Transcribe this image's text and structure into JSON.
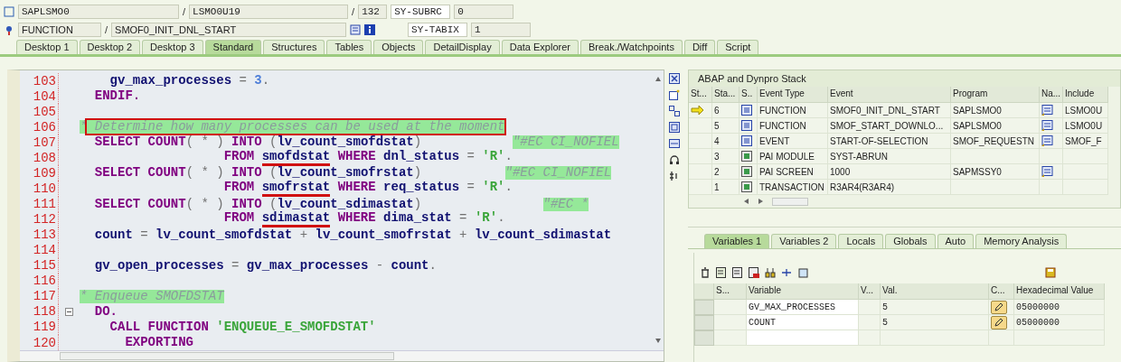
{
  "header": {
    "row_1": {
      "program": "SAPLSMO0",
      "separator_1": "/",
      "include": "LSMO0U19",
      "separator_2": "/",
      "line": "132",
      "field_name": "SY-SUBRC",
      "field_value": "0"
    },
    "row_2": {
      "event_type": "FUNCTION",
      "separator": "/",
      "event": "SMOF0_INIT_DNL_START",
      "field_name": "SY-TABIX",
      "field_value": "1"
    }
  },
  "tabs": [
    {
      "label": "Desktop 1",
      "selected": false
    },
    {
      "label": "Desktop 2",
      "selected": false
    },
    {
      "label": "Desktop 3",
      "selected": false
    },
    {
      "label": "Standard",
      "selected": true
    },
    {
      "label": "Structures",
      "selected": false
    },
    {
      "label": "Tables",
      "selected": false
    },
    {
      "label": "Objects",
      "selected": false
    },
    {
      "label": "DetailDisplay",
      "selected": false
    },
    {
      "label": "Data Explorer",
      "selected": false
    },
    {
      "label": "Break./Watchpoints",
      "selected": false
    },
    {
      "label": "Diff",
      "selected": false
    },
    {
      "label": "Script",
      "selected": false
    }
  ],
  "code": {
    "lines": [
      {
        "number": "103",
        "tokens": [
          {
            "kind": "id",
            "text": "    gv_max_processes"
          },
          {
            "kind": "op",
            "text": " = "
          },
          {
            "kind": "num",
            "text": "3"
          },
          {
            "kind": "op",
            "text": "."
          }
        ]
      },
      {
        "number": "104",
        "tokens": [
          {
            "kind": "kw",
            "text": "  ENDIF."
          }
        ]
      },
      {
        "number": "105"
      },
      {
        "number": "106",
        "tokens": [
          {
            "kind": "comment",
            "text": "*",
            "highlighted": true
          },
          {
            "kind": "comment",
            "text": " Determine how many processes can be used at the moment",
            "highlighted": true,
            "boxed": true
          }
        ]
      },
      {
        "number": "107",
        "tokens": [
          {
            "kind": "kw",
            "text": "  SELECT COUNT"
          },
          {
            "kind": "op",
            "text": "( * ) "
          },
          {
            "kind": "kw",
            "text": "INTO "
          },
          {
            "kind": "op",
            "text": "("
          },
          {
            "kind": "id",
            "text": "lv_count_smofdstat"
          },
          {
            "kind": "op",
            "text": ")            "
          },
          {
            "kind": "comment",
            "text": "\"#EC CI_NOFIEL",
            "highlighted": true
          }
        ]
      },
      {
        "number": "108",
        "tokens": [
          {
            "kind": "kw",
            "text": "                   FROM "
          },
          {
            "kind": "id",
            "text": "smofdstat",
            "marked": true
          },
          {
            "kind": "kw",
            "text": " WHERE "
          },
          {
            "kind": "id",
            "text": "dnl_status"
          },
          {
            "kind": "op",
            "text": " = "
          },
          {
            "kind": "str",
            "text": "'R'"
          },
          {
            "kind": "op",
            "text": "."
          }
        ]
      },
      {
        "number": "109",
        "tokens": [
          {
            "kind": "kw",
            "text": "  SELECT COUNT"
          },
          {
            "kind": "op",
            "text": "( * ) "
          },
          {
            "kind": "kw",
            "text": "INTO "
          },
          {
            "kind": "op",
            "text": "("
          },
          {
            "kind": "id",
            "text": "lv_count_smofrstat"
          },
          {
            "kind": "op",
            "text": ")           "
          },
          {
            "kind": "comment",
            "text": "\"#EC CI_NOFIEL",
            "highlighted": true
          }
        ]
      },
      {
        "number": "110",
        "tokens": [
          {
            "kind": "kw",
            "text": "                   FROM "
          },
          {
            "kind": "id",
            "text": "smofrstat",
            "marked": true
          },
          {
            "kind": "kw",
            "text": " WHERE "
          },
          {
            "kind": "id",
            "text": "req_status"
          },
          {
            "kind": "op",
            "text": " = "
          },
          {
            "kind": "str",
            "text": "'R'"
          },
          {
            "kind": "op",
            "text": "."
          }
        ]
      },
      {
        "number": "111",
        "tokens": [
          {
            "kind": "kw",
            "text": "  SELECT COUNT"
          },
          {
            "kind": "op",
            "text": "( * ) "
          },
          {
            "kind": "kw",
            "text": "INTO "
          },
          {
            "kind": "op",
            "text": "("
          },
          {
            "kind": "id",
            "text": "lv_count_sdimastat"
          },
          {
            "kind": "op",
            "text": ")                "
          },
          {
            "kind": "comment",
            "text": "\"#EC *",
            "highlighted": true
          }
        ]
      },
      {
        "number": "112",
        "tokens": [
          {
            "kind": "kw",
            "text": "                   FROM "
          },
          {
            "kind": "id",
            "text": "sdimastat",
            "marked": true
          },
          {
            "kind": "kw",
            "text": " WHERE "
          },
          {
            "kind": "id",
            "text": "dima_stat"
          },
          {
            "kind": "op",
            "text": " = "
          },
          {
            "kind": "str",
            "text": "'R'"
          },
          {
            "kind": "op",
            "text": "."
          }
        ]
      },
      {
        "number": "113",
        "tokens": [
          {
            "kind": "id",
            "text": "  count"
          },
          {
            "kind": "op",
            "text": " = "
          },
          {
            "kind": "id",
            "text": "lv_count_smofdstat"
          },
          {
            "kind": "op",
            "text": " + "
          },
          {
            "kind": "id",
            "text": "lv_count_smofrstat"
          },
          {
            "kind": "op",
            "text": " + "
          },
          {
            "kind": "id",
            "text": "lv_count_sdimastat"
          }
        ]
      },
      {
        "number": "114"
      },
      {
        "number": "115",
        "tokens": [
          {
            "kind": "id",
            "text": "  gv_open_processes"
          },
          {
            "kind": "op",
            "text": " = "
          },
          {
            "kind": "id",
            "text": "gv_max_processes"
          },
          {
            "kind": "op",
            "text": " - "
          },
          {
            "kind": "id",
            "text": "count"
          },
          {
            "kind": "op",
            "text": "."
          }
        ]
      },
      {
        "number": "116"
      },
      {
        "number": "117",
        "tokens": [
          {
            "kind": "comment",
            "text": "* Enqueue SMOFDSTAT",
            "highlighted": true
          }
        ]
      },
      {
        "number": "118",
        "fold": true,
        "tokens": [
          {
            "kind": "kw",
            "text": "  DO."
          }
        ]
      },
      {
        "number": "119",
        "tokens": [
          {
            "kind": "kw",
            "text": "    CALL FUNCTION "
          },
          {
            "kind": "str",
            "text": "'ENQUEUE_E_SMOFDSTAT'"
          }
        ]
      },
      {
        "number": "120",
        "tokens": [
          {
            "kind": "kw",
            "text": "      EXPORTING"
          }
        ]
      }
    ]
  },
  "stack": {
    "title": "ABAP and Dynpro Stack",
    "columns": [
      "St...",
      "Sta...",
      "S..",
      "Event Type",
      "Event",
      "Program",
      "Na...",
      "Include"
    ],
    "rows": [
      {
        "current": true,
        "level": "6",
        "kind": "function",
        "event_type": "FUNCTION",
        "event": "SMOF0_INIT_DNL_START",
        "program": "SAPLSMO0",
        "navigable": true,
        "include": "LSMO0U"
      },
      {
        "current": false,
        "level": "5",
        "kind": "function",
        "event_type": "FUNCTION",
        "event": "SMOF_START_DOWNLO...",
        "program": "SAPLSMO0",
        "navigable": true,
        "include": "LSMO0U"
      },
      {
        "current": false,
        "level": "4",
        "kind": "function",
        "event_type": "EVENT",
        "event": "START-OF-SELECTION",
        "program": "SMOF_REQUESTN",
        "navigable": true,
        "include": "SMOF_F"
      },
      {
        "current": false,
        "level": "3",
        "kind": "screen",
        "event_type": "PAI MODULE",
        "event": "SYST-ABRUN",
        "program": "",
        "navigable": false,
        "include": ""
      },
      {
        "current": false,
        "level": "2",
        "kind": "screen",
        "event_type": "PAI SCREEN",
        "event": "1000",
        "program": "SAPMSSY0",
        "navigable": true,
        "include": ""
      },
      {
        "current": false,
        "level": "1",
        "kind": "screen",
        "event_type": "TRANSACTION",
        "event": "R3AR4(R3AR4)",
        "program": "",
        "navigable": false,
        "include": ""
      }
    ]
  },
  "variable_tabs": [
    {
      "label": "Variables 1",
      "selected": true
    },
    {
      "label": "Variables 2",
      "selected": false
    },
    {
      "label": "Locals",
      "selected": false
    },
    {
      "label": "Globals",
      "selected": false
    },
    {
      "label": "Auto",
      "selected": false
    },
    {
      "label": "Memory Analysis",
      "selected": false
    }
  ],
  "variables": {
    "columns": [
      "S...",
      "Variable",
      "V...",
      "Val.",
      "C...",
      "Hexadecimal Value"
    ],
    "rows": [
      {
        "name": "GV_MAX_PROCESSES",
        "value": "5",
        "editable": true,
        "hex": "05000000"
      },
      {
        "name": "COUNT",
        "value": "5",
        "editable": true,
        "hex": "05000000"
      }
    ]
  }
}
